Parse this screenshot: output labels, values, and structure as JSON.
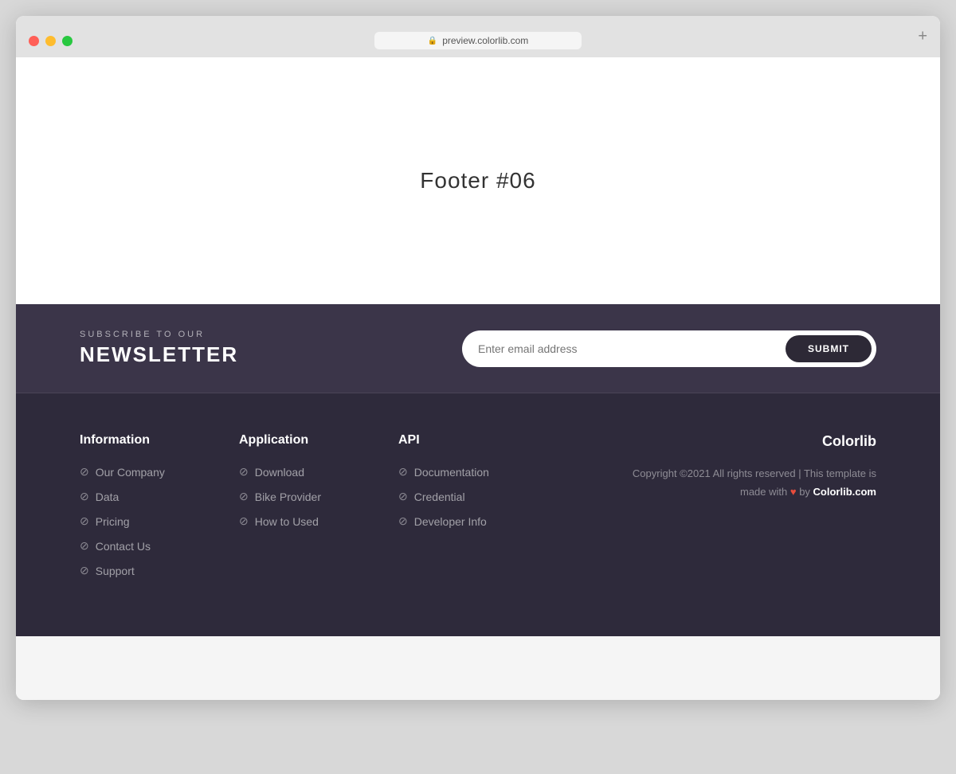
{
  "browser": {
    "url": "preview.colorlib.com",
    "new_tab_label": "+"
  },
  "header": {
    "title": "Footer #06"
  },
  "newsletter": {
    "subscribe_label": "SUBSCRIBE TO OUR",
    "newsletter_title": "NEWSLETTER",
    "email_placeholder": "Enter email address",
    "submit_label": "SUBMIT"
  },
  "footer": {
    "columns": [
      {
        "id": "information",
        "heading": "Information",
        "links": [
          "Our Company",
          "Data",
          "Pricing",
          "Contact Us",
          "Support"
        ]
      },
      {
        "id": "application",
        "heading": "Application",
        "links": [
          "Download",
          "Bike Provider",
          "How to Used"
        ]
      },
      {
        "id": "api",
        "heading": "API",
        "links": [
          "Documentation",
          "Credential",
          "Developer Info"
        ]
      }
    ],
    "brand": "Colorlib",
    "copyright_text": "Copyright ©2021 All rights reserved | This template is made with",
    "copyright_link": "Colorlib.com"
  }
}
